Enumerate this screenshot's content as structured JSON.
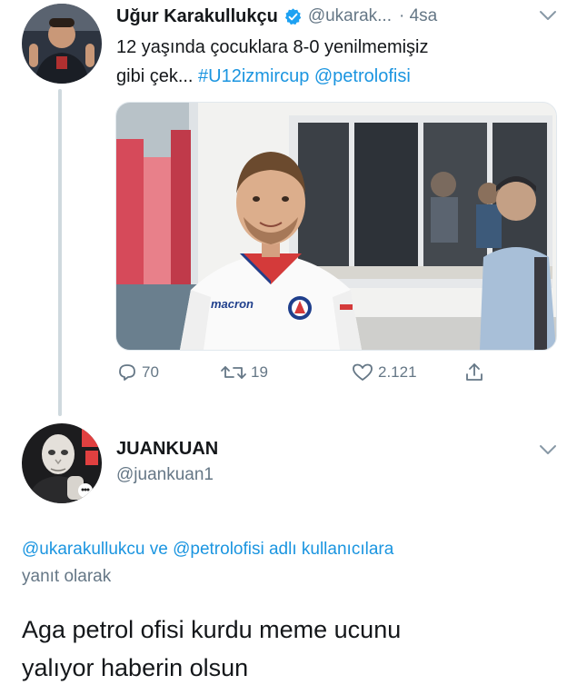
{
  "tweet": {
    "author": {
      "display_name": "Uğur Karakullukçu",
      "handle": "@ukarak...",
      "time": "· 4sa"
    },
    "text_parts": {
      "line1": "12 yaşında çocuklara 8-0 yenilmemişiz",
      "line2": "gibi çek... ",
      "hashtag": "#U12izmircup",
      "space": " ",
      "mention": "@petrolofisi"
    },
    "media": {
      "jersey_brand": "macron"
    },
    "stats": {
      "replies": "70",
      "retweets": "19",
      "likes": "2.121"
    }
  },
  "reply": {
    "author": {
      "display_name": "JUANKUAN",
      "handle": "@juankuan1"
    },
    "reply_to": {
      "mention1": "@ukarakullukcu",
      "connector": " ve ",
      "mention2": "@petrolofisi",
      "tail1": " adlı kullanıcılara",
      "tail2": "yanıt olarak"
    },
    "text_parts": {
      "line1": "Aga petrol ofisi kurdu meme ucunu",
      "line2": "yalıyor haberin olsun"
    }
  },
  "icons": {
    "verified": "verified-badge-icon",
    "chevron": "chevron-down-icon",
    "reply": "reply-icon",
    "retweet": "retweet-icon",
    "like": "heart-icon",
    "share": "share-icon"
  },
  "colors": {
    "link": "#1b95e0",
    "secondary_text": "#657786",
    "primary_text": "#14171a",
    "verified": "#1da1f2"
  }
}
